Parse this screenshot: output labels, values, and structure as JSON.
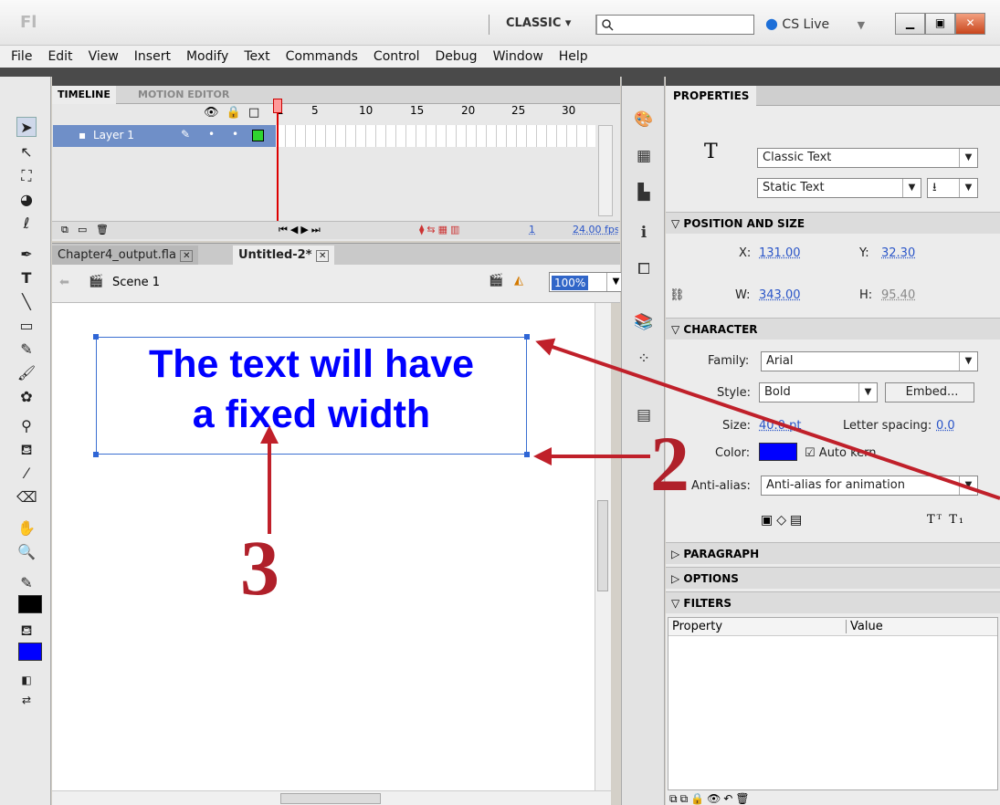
{
  "app": {
    "logo": "Fl",
    "workspace": "CLASSIC ▾",
    "cs_live": "CS Live"
  },
  "menu": [
    "File",
    "Edit",
    "View",
    "Insert",
    "Modify",
    "Text",
    "Commands",
    "Control",
    "Debug",
    "Window",
    "Help"
  ],
  "timeline": {
    "tab_active": "TIMELINE",
    "tab_other": "MOTION EDITOR",
    "frame_numbers": [
      "1",
      "5",
      "10",
      "15",
      "20",
      "25",
      "30"
    ],
    "layer_name": "Layer 1",
    "current_frame": "1",
    "fps": "24.00 fps"
  },
  "docs": {
    "tab1": "Chapter4_output.fla",
    "tab2": "Untitled-2*",
    "scene": "Scene 1",
    "zoom": "100%"
  },
  "stage": {
    "text_line1": "The text will have",
    "text_line2": "a fixed width"
  },
  "properties": {
    "tab": "PROPERTIES",
    "text_engine": "Classic Text",
    "text_type": "Static Text",
    "position_section": "POSITION AND SIZE",
    "x_label": "X:",
    "x": "131.00",
    "y_label": "Y:",
    "y": "32.30",
    "w_label": "W:",
    "w": "343.00",
    "h_label": "H:",
    "h": "95.40",
    "character_section": "CHARACTER",
    "family_label": "Family:",
    "family": "Arial",
    "style_label": "Style:",
    "style": "Bold",
    "embed": "Embed...",
    "size_label": "Size:",
    "size": "40.0 pt",
    "spacing_label": "Letter spacing:",
    "spacing": "0.0",
    "color_label": "Color:",
    "color": "#0000ff",
    "autokern": "Auto kern",
    "antialias_label": "Anti-alias:",
    "antialias": "Anti-alias for animation",
    "paragraph_section": "PARAGRAPH",
    "options_section": "OPTIONS",
    "filters_section": "FILTERS",
    "col_property": "Property",
    "col_value": "Value"
  },
  "annotations": {
    "two": "2",
    "three": "3"
  }
}
